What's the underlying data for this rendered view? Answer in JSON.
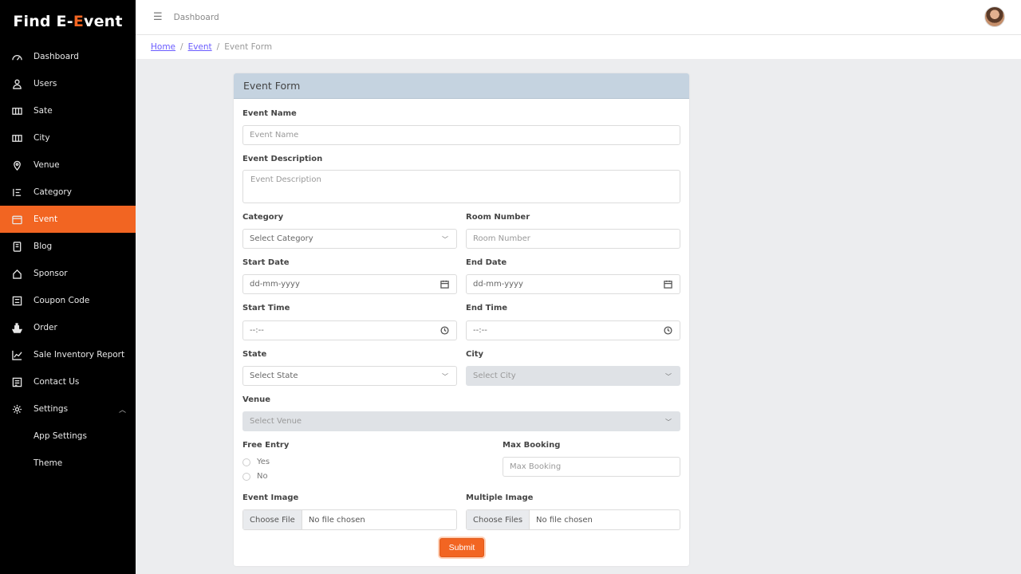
{
  "app": {
    "logo_part1": "Find E-",
    "logo_part2": "E",
    "logo_part3": "vent"
  },
  "sidebar": {
    "items": [
      {
        "label": "Dashboard",
        "icon": "dashboard-icon"
      },
      {
        "label": "Users",
        "icon": "user-icon"
      },
      {
        "label": "Sate",
        "icon": "map-icon"
      },
      {
        "label": "City",
        "icon": "map-icon"
      },
      {
        "label": "Venue",
        "icon": "location-pin-icon"
      },
      {
        "label": "Category",
        "icon": "list-icon"
      },
      {
        "label": "Event",
        "icon": "calendar-icon"
      },
      {
        "label": "Blog",
        "icon": "book-icon"
      },
      {
        "label": "Sponsor",
        "icon": "home-icon"
      },
      {
        "label": "Coupon Code",
        "icon": "coupon-icon"
      },
      {
        "label": "Order",
        "icon": "ship-icon"
      },
      {
        "label": "Sale Inventory Report",
        "icon": "chart-icon"
      },
      {
        "label": "Contact Us",
        "icon": "contact-icon"
      },
      {
        "label": "Settings",
        "icon": "gear-icon"
      }
    ],
    "sub_items": [
      {
        "label": "App Settings"
      },
      {
        "label": "Theme"
      }
    ],
    "active": "Event"
  },
  "topbar": {
    "title": "Dashboard"
  },
  "breadcrumb": {
    "home": "Home",
    "event": "Event",
    "current": "Event Form",
    "sep": "/"
  },
  "form": {
    "title": "Event Form",
    "event_name": {
      "label": "Event Name",
      "placeholder": "Event Name"
    },
    "event_description": {
      "label": "Event Description",
      "placeholder": "Event Description"
    },
    "category": {
      "label": "Category",
      "value": "Select Category"
    },
    "room_number": {
      "label": "Room Number",
      "placeholder": "Room Number"
    },
    "start_date": {
      "label": "Start Date",
      "value": "dd-mm-yyyy"
    },
    "end_date": {
      "label": "End Date",
      "value": "dd-mm-yyyy"
    },
    "start_time": {
      "label": "Start Time",
      "value": "--:--"
    },
    "end_time": {
      "label": "End Time",
      "value": "--:--"
    },
    "state": {
      "label": "State",
      "value": "Select State"
    },
    "city": {
      "label": "City",
      "value": "Select City"
    },
    "venue": {
      "label": "Venue",
      "value": "Select Venue"
    },
    "free_entry": {
      "label": "Free Entry",
      "options": [
        "Yes",
        "No"
      ]
    },
    "max_booking": {
      "label": "Max Booking",
      "placeholder": "Max Booking"
    },
    "event_image": {
      "label": "Event Image",
      "button": "Choose File",
      "status": "No file chosen"
    },
    "multiple_image": {
      "label": "Multiple Image",
      "button": "Choose Files",
      "status": "No file chosen"
    },
    "submit": "Submit"
  },
  "colors": {
    "accent": "#f26522",
    "sidebar_bg": "#000000",
    "card_header": "#c5d3e0"
  }
}
